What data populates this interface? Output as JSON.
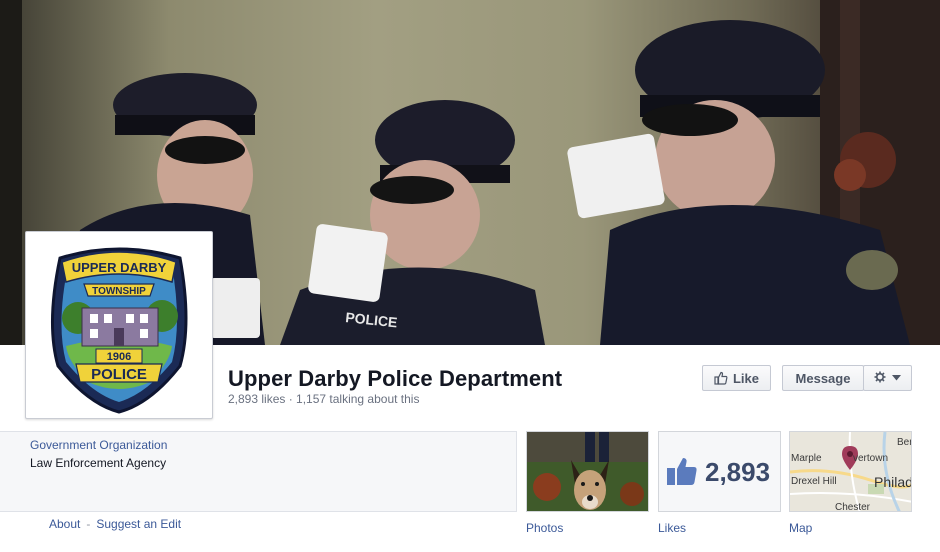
{
  "page": {
    "name": "Upper Darby Police Department",
    "stats": "2,893 likes · 1,157 talking about this"
  },
  "badge": {
    "top": "UPPER DARBY",
    "middle": "TOWNSHIP",
    "year": "1906",
    "bottom": "POLICE"
  },
  "cover": {
    "patch_text": "POLICE"
  },
  "buttons": {
    "like": "Like",
    "message": "Message"
  },
  "info": {
    "category": "Government Organization",
    "subcategory": "Law Enforcement Agency"
  },
  "links": {
    "about": "About",
    "separator": "-",
    "suggest": "Suggest an Edit"
  },
  "tiles": {
    "photos_label": "Photos",
    "likes_label": "Likes",
    "likes_count": "2,893",
    "map_label": "Map"
  },
  "map": {
    "places": [
      "Marple",
      "vertown",
      "Drexel Hill",
      "Philad",
      "Chester",
      "Ber"
    ]
  },
  "colors": {
    "link": "#3b5998",
    "name": "#141823",
    "muted": "#6a7180"
  },
  "icons": {
    "like_button": "thumbs-up-icon",
    "settings": "gear-icon",
    "dropdown": "chevron-down-icon",
    "map_pin": "map-pin-icon"
  }
}
